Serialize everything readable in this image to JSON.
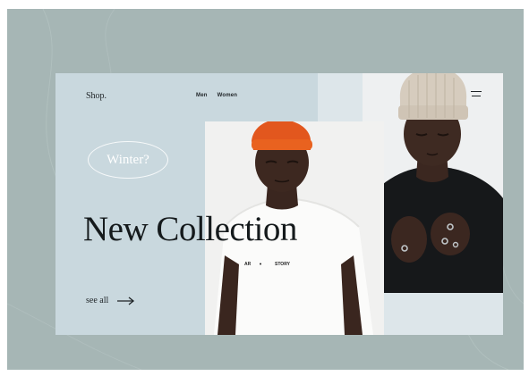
{
  "header": {
    "logo": "Shop.",
    "nav": [
      {
        "label": "Men"
      },
      {
        "label": "Women"
      }
    ],
    "menu_icon": "hamburger-menu-icon"
  },
  "hero": {
    "tag": "Winter?",
    "headline": "New Collection",
    "cta_label": "see all",
    "cta_icon": "arrow-right-icon",
    "tshirt_print_left": "AR",
    "tshirt_print_right": "STORY"
  },
  "colors": {
    "backdrop": "#a6b6b5",
    "panel": "#c9d8de",
    "text": "#151a1c",
    "beanie_orange": "#e2571e",
    "beanie_beige": "#d9cfc1"
  }
}
